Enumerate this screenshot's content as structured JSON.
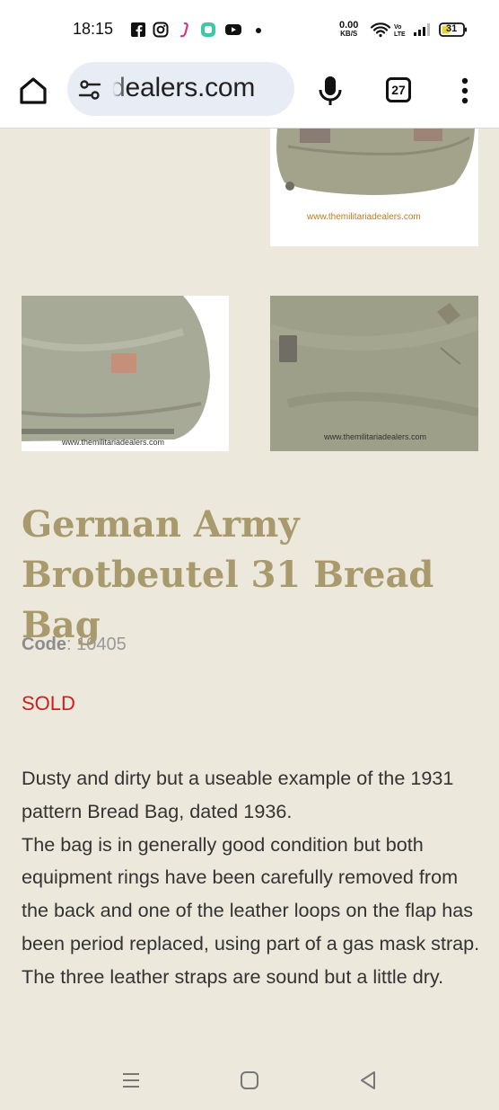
{
  "status_bar": {
    "time": "18:15",
    "speed_value": "0.00",
    "speed_unit": "KB/S",
    "battery": "31",
    "icons": [
      "facebook-icon",
      "instagram-icon",
      "app-icon",
      "app-icon",
      "youtube-icon",
      "dot-icon",
      "wifi-icon",
      "volte-icon",
      "signal-icon",
      "battery-icon"
    ]
  },
  "browser": {
    "url": "dealers.com",
    "tab_count": "27",
    "icons": [
      "home-icon",
      "tune-icon",
      "mic-icon",
      "tabs-icon",
      "more-icon"
    ]
  },
  "gallery": {
    "watermarks": [
      "www.themilitariadealers.com",
      "www.themilitariadealers.com",
      "www.themilitariadealers.com"
    ]
  },
  "product": {
    "title": "German Army Brotbeutel 31 Bread Bag",
    "code_label": "Code",
    "code_value": "10405",
    "status": "SOLD",
    "description": [
      "Dusty and dirty but a useable example of the 1931 pattern Bread Bag, dated 1936.",
      "The bag is in generally good condition but both equipment rings have been carefully removed from the back and one of the leather loops on the flap has been period replaced, using part of a gas mask strap.",
      "The three leather straps are sound but a little dry."
    ]
  },
  "colors": {
    "page_background": "#ece8dc",
    "title": "#a89a6c",
    "sold": "#cc1f1f",
    "text": "#333333"
  },
  "nav": {
    "icons": [
      "recents-icon",
      "home-circle-icon",
      "back-icon"
    ]
  }
}
